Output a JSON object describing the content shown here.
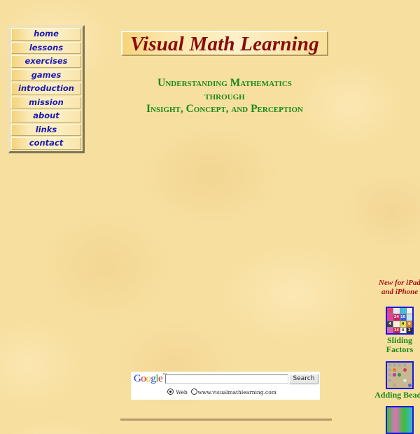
{
  "nav": {
    "items": [
      {
        "label": "home"
      },
      {
        "label": "lessons"
      },
      {
        "label": "exercises"
      },
      {
        "label": "games"
      },
      {
        "label": "introduction"
      },
      {
        "label": "mission"
      },
      {
        "label": "about"
      },
      {
        "label": "links"
      },
      {
        "label": "contact"
      }
    ]
  },
  "header": {
    "title": "Visual Math Learning"
  },
  "subtitle": {
    "line1": "Understanding Mathematics",
    "line2": "through",
    "line3": "Insight, Concept, and Perception"
  },
  "search": {
    "logo": "Google",
    "logo_tm": "™",
    "input_value": "",
    "button_label": "Search",
    "option_web": "Web",
    "option_site": "www.visualmathlearning.com",
    "selected": "Web"
  },
  "apps": {
    "note_line1": "New for iPad",
    "note_line2": "and iPhone",
    "items": [
      {
        "label_line1": "Sliding",
        "label_line2": "Factors"
      },
      {
        "label_line1": "Adding Beads",
        "label_line2": ""
      }
    ],
    "sliding_factors_tiles": [
      "",
      "",
      "",
      "",
      "",
      "24",
      "10",
      "",
      "4",
      "",
      "4",
      "6",
      "",
      "14",
      "4",
      "2"
    ]
  },
  "colors": {
    "nav_text": "#1c1cae",
    "title": "#8b0a0a",
    "subtitle": "#1a8a1a",
    "new_note": "#b01010",
    "app_label": "#1a8a1a",
    "app_border": "#1a1adc"
  }
}
